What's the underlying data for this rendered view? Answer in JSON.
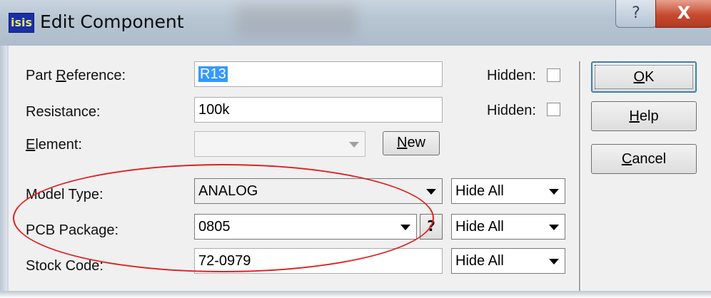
{
  "window": {
    "title": "Edit Component",
    "app_icon": "isis",
    "help_glyph": "?",
    "close_glyph": "X"
  },
  "fields": {
    "part_reference": {
      "label": "Part Reference:",
      "value": "R13",
      "hidden_label": "Hidden:"
    },
    "resistance": {
      "label": "Resistance:",
      "value": "100k",
      "hidden_label": "Hidden:"
    },
    "element": {
      "label": "Element:",
      "value": "",
      "new_label": "New"
    },
    "model_type": {
      "label": "Model Type:",
      "value": "ANALOG",
      "visibility": "Hide All"
    },
    "pcb_package": {
      "label": "PCB Package:",
      "value": "0805",
      "help": "?",
      "visibility": "Hide All"
    },
    "stock_code": {
      "label": "Stock Code:",
      "value": "72-0979",
      "visibility": "Hide All"
    }
  },
  "buttons": {
    "ok": "OK",
    "help": "Help",
    "cancel": "Cancel"
  },
  "colors": {
    "annotation": "#e02020",
    "selection": "#3399ff"
  }
}
